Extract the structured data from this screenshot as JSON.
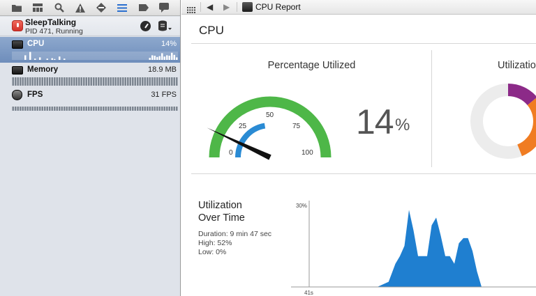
{
  "navigator": {
    "toolbar_icons": [
      "folder-icon",
      "hierarchy-icon",
      "search-icon",
      "warning-icon",
      "test-diamond-icon",
      "debug-list-icon",
      "breakpoint-icon",
      "log-bubble-icon"
    ],
    "process": {
      "name": "SleepTalking",
      "status": "PID 471, Running"
    },
    "gauges": [
      {
        "label": "CPU",
        "value": "14%",
        "selected": true,
        "spark": [
          0,
          0,
          0,
          0,
          0,
          0.55,
          0,
          0.95,
          0,
          0.15,
          0,
          0.3,
          0,
          0,
          0.15,
          0,
          0.2,
          0.1,
          0,
          0.4,
          0,
          0.15,
          0,
          0,
          0,
          0,
          0,
          0,
          0,
          0,
          0,
          0,
          0,
          0,
          0,
          0,
          0,
          0,
          0,
          0,
          0,
          0,
          0,
          0,
          0,
          0,
          0,
          0,
          0,
          0,
          0,
          0,
          0,
          0,
          0,
          0,
          0.25,
          0.55,
          0.5,
          0.35,
          0.45,
          0.8,
          0.4,
          0.55,
          0.5,
          0.85,
          0.6,
          0.3
        ]
      },
      {
        "label": "Memory",
        "value": "18.9 MB",
        "selected": false,
        "spark": [
          1,
          1,
          1,
          1,
          1,
          1,
          1,
          1,
          1,
          1,
          1,
          1,
          1,
          1,
          1,
          1,
          1,
          1,
          1,
          1,
          1,
          1,
          1,
          1,
          1,
          1,
          1,
          1,
          1,
          1,
          1,
          1,
          1,
          1,
          1,
          1,
          1,
          1,
          1,
          1,
          1,
          1,
          1,
          1,
          1,
          1,
          1,
          1,
          1,
          1,
          1,
          1,
          1,
          1,
          1,
          1,
          1,
          1,
          1,
          1,
          1,
          1,
          1,
          1,
          1,
          1,
          1,
          1
        ]
      },
      {
        "label": "FPS",
        "value": "31 FPS",
        "selected": false,
        "spark": [
          0.5,
          0.5,
          0.5,
          0.5,
          0.5,
          0.5,
          0.5,
          0.5,
          0.5,
          0.5,
          0.5,
          0.5,
          0.5,
          0.5,
          0.5,
          0.5,
          0.5,
          0.5,
          0.5,
          0.5,
          0.5,
          0.5,
          0.5,
          0.5,
          0.5,
          0.5,
          0.5,
          0.5,
          0.5,
          0.5,
          0.5,
          0.5,
          0.5,
          0.5,
          0.5,
          0.5,
          0.5,
          0.5,
          0.5,
          0.5,
          0.5,
          0.5,
          0.5,
          0.5,
          0.5,
          0.5,
          0.5,
          0.5,
          0.5,
          0.5,
          0.5,
          0.5,
          0.5,
          0.5,
          0.5,
          0.5,
          0.5,
          0.5,
          0.5,
          0.5,
          0.5,
          0.5,
          0.5,
          0.5,
          0.5,
          0.5,
          0.5,
          0.5
        ]
      }
    ]
  },
  "editor": {
    "back_glyph": "◀",
    "forward_glyph": "▶",
    "title": "CPU Report"
  },
  "report": {
    "header": "CPU",
    "percentage_title": "Percentage Utilized",
    "utilization_title": "Utilization",
    "big_value": "14",
    "big_unit": "%",
    "gauge": {
      "value": 14,
      "ticks": [
        "0",
        "25",
        "50",
        "75",
        "100"
      ]
    },
    "donut": {
      "slices": [
        {
          "value": 14,
          "color": "#8c2a88"
        },
        {
          "value": 30,
          "color": "#f07c22"
        },
        {
          "value": 56,
          "color": "#ececec"
        }
      ]
    },
    "over_time": {
      "title_line1": "Utilization",
      "title_line2": "Over Time",
      "duration": "Duration: 9 min 47 sec",
      "high": "High: 52%",
      "low": "Low: 0%"
    }
  },
  "colors": {
    "selection": "#7694c2",
    "gauge_outer": "#4eb748",
    "gauge_inner": "#2a8bd4",
    "chart_fill": "#1f7fd0"
  },
  "chart_data": {
    "type": "area",
    "ylabel_tick": "30%",
    "xlabel_tick": "41s",
    "x": [
      0,
      30,
      35,
      38,
      40,
      42,
      44,
      46,
      48,
      50,
      52,
      54,
      56,
      58,
      60,
      62,
      64,
      66,
      68,
      70,
      72,
      74,
      76,
      100
    ],
    "values": [
      0,
      0,
      2,
      9,
      12,
      16,
      30,
      22,
      12,
      12,
      12,
      24,
      27,
      20,
      12,
      12,
      9,
      17,
      19,
      19,
      14,
      6,
      0,
      0
    ],
    "ylim": [
      0,
      32
    ],
    "series": [
      {
        "color": "#1f7fd0"
      }
    ]
  }
}
